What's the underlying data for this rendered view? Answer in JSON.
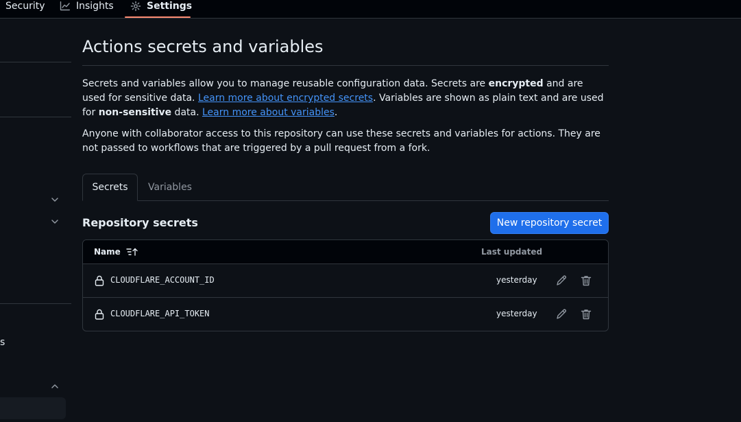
{
  "nav": {
    "security": "Security",
    "insights": "Insights",
    "settings": "Settings"
  },
  "sidebar": {
    "partial_item_text": "s"
  },
  "page": {
    "title": "Actions secrets and variables",
    "intro": {
      "part1": "Secrets and variables allow you to manage reusable configuration data. Secrets are ",
      "bold1": "encrypted",
      "part2": " and are used for sensitive data. ",
      "link1": "Learn more about encrypted secrets",
      "part3": ". Variables are shown as plain text and are used for ",
      "bold2": "non-sensitive",
      "part4": " data. ",
      "link2": "Learn more about variables",
      "part5": "."
    },
    "access_note": "Anyone with collaborator access to this repository can use these secrets and variables for actions. They are not passed to workflows that are triggered by a pull request from a fork."
  },
  "tabs": {
    "secrets": "Secrets",
    "variables": "Variables"
  },
  "repo_secrets": {
    "title": "Repository secrets",
    "new_button": "New repository secret",
    "columns": {
      "name": "Name",
      "last_updated": "Last updated"
    },
    "rows": [
      {
        "name": "CLOUDFLARE_ACCOUNT_ID",
        "updated": "yesterday"
      },
      {
        "name": "CLOUDFLARE_API_TOKEN",
        "updated": "yesterday"
      }
    ]
  },
  "colors": {
    "background": "#0d1117",
    "accent_button": "#1f6feb",
    "link": "#4493f8",
    "nav_underline": "#fd8c73"
  }
}
